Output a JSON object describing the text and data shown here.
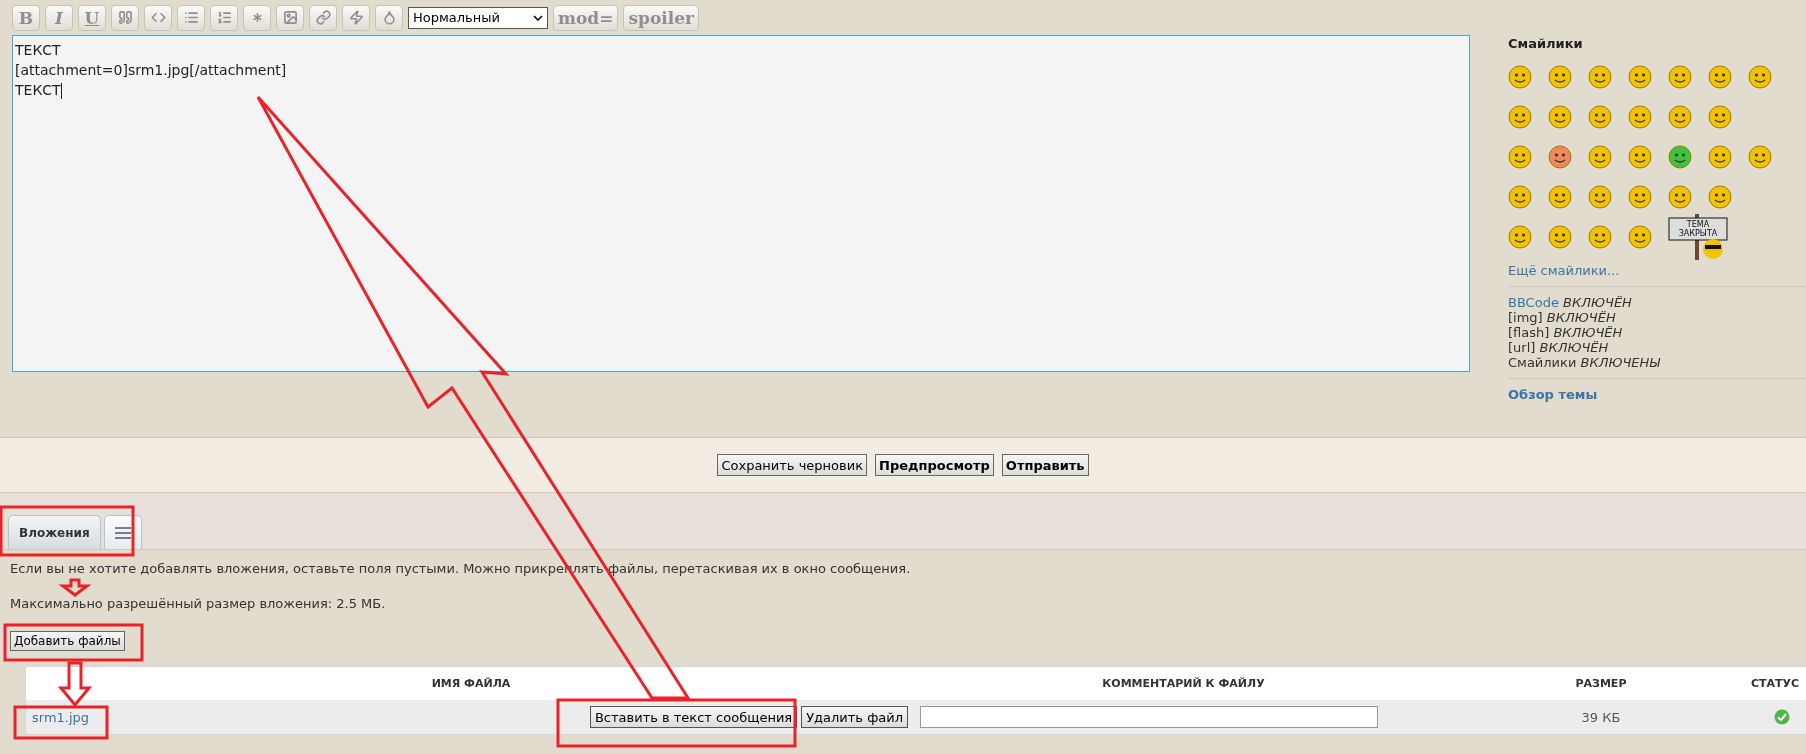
{
  "toolbar": {
    "format_buttons": [
      "B",
      "I",
      "U"
    ],
    "size_select": "Нормальный",
    "tag_buttons": [
      "mod=",
      "spoiler"
    ]
  },
  "message": {
    "lines": [
      "ТЕКСТ",
      "[attachment=0]srm1.jpg[/attachment]",
      "ТЕКСТ"
    ]
  },
  "sidebar": {
    "title": "Смайлики",
    "smiley_rows": [
      [
        {
          "color": "#f2c200"
        },
        {
          "color": "#f2c200"
        },
        {
          "color": "#f2c200"
        },
        {
          "color": "#f2c200"
        },
        {
          "color": "#f2c200"
        },
        {
          "color": "#f2c200"
        },
        {
          "color": "#f2c200"
        }
      ],
      [
        {
          "color": "#f2c200"
        },
        {
          "color": "#f2c200"
        },
        {
          "color": "#f2c200"
        },
        {
          "color": "#f2c200"
        },
        {
          "color": "#f2c200"
        },
        {
          "color": "#f2c200"
        }
      ],
      [
        {
          "color": "#f2c200"
        },
        {
          "color": "#f08a5d"
        },
        {
          "color": "#f2c200"
        },
        {
          "color": "#f2c200"
        },
        {
          "color": "#3cc43c"
        },
        {
          "color": "#f2c200"
        },
        {
          "color": "#f2c200"
        }
      ],
      [
        {
          "color": "#f2c200"
        },
        {
          "color": "#f2c200"
        },
        {
          "color": "#f2c200"
        },
        {
          "color": "#f2c200"
        },
        {
          "color": "#f2c200"
        },
        {
          "color": "#f2c200"
        }
      ],
      [
        {
          "color": "#f2c200"
        },
        {
          "color": "#f2c200"
        },
        {
          "color": "#f2c200"
        },
        {
          "color": "#f2c200"
        },
        {
          "color": "#f2c200",
          "sign": "ТЕМА ЗАКРЫТА"
        }
      ]
    ],
    "more_link": "Ещё смайлики...",
    "options": [
      {
        "label": "BBCode",
        "state": "ВКЛЮЧЁН",
        "kind": "link"
      },
      {
        "label": "[img]",
        "state": "ВКЛЮЧЁН",
        "kind": "text"
      },
      {
        "label": "[flash]",
        "state": "ВКЛЮЧЁН",
        "kind": "text"
      },
      {
        "label": "[url]",
        "state": "ВКЛЮЧЁН",
        "kind": "text"
      },
      {
        "label": "Смайлики",
        "state": "ВКЛЮЧЕНЫ",
        "kind": "text"
      }
    ],
    "topic_link": "Обзор темы"
  },
  "submit_buttons": [
    {
      "label": "Сохранить черновик",
      "bold": false
    },
    {
      "label": "Предпросмотр",
      "bold": true
    },
    {
      "label": "Отправить",
      "bold": true
    }
  ],
  "tabs": [
    {
      "label": "Вложения",
      "kind": "text",
      "selected": true
    },
    {
      "kind": "menu",
      "selected": false
    }
  ],
  "attachments": {
    "hint": "Если вы не хотите добавлять вложения, оставьте поля пустыми. Можно прикреплять файлы, перетаскивая их в окно сообщения.",
    "max_size": "Максимально разрешённый размер вложения: 2.5 МБ.",
    "add_button": "Добавить файлы",
    "table": {
      "columns": [
        "ИМЯ ФАЙЛА",
        "КОММЕНТАРИЙ К ФАЙЛУ",
        "РАЗМЕР",
        "СТАТУС"
      ],
      "rows": [
        {
          "file": "srm1.jpg",
          "insert_button": "Вставить в текст сообщения",
          "delete_button": "Удалить файл",
          "size": "39 КБ"
        }
      ]
    }
  }
}
